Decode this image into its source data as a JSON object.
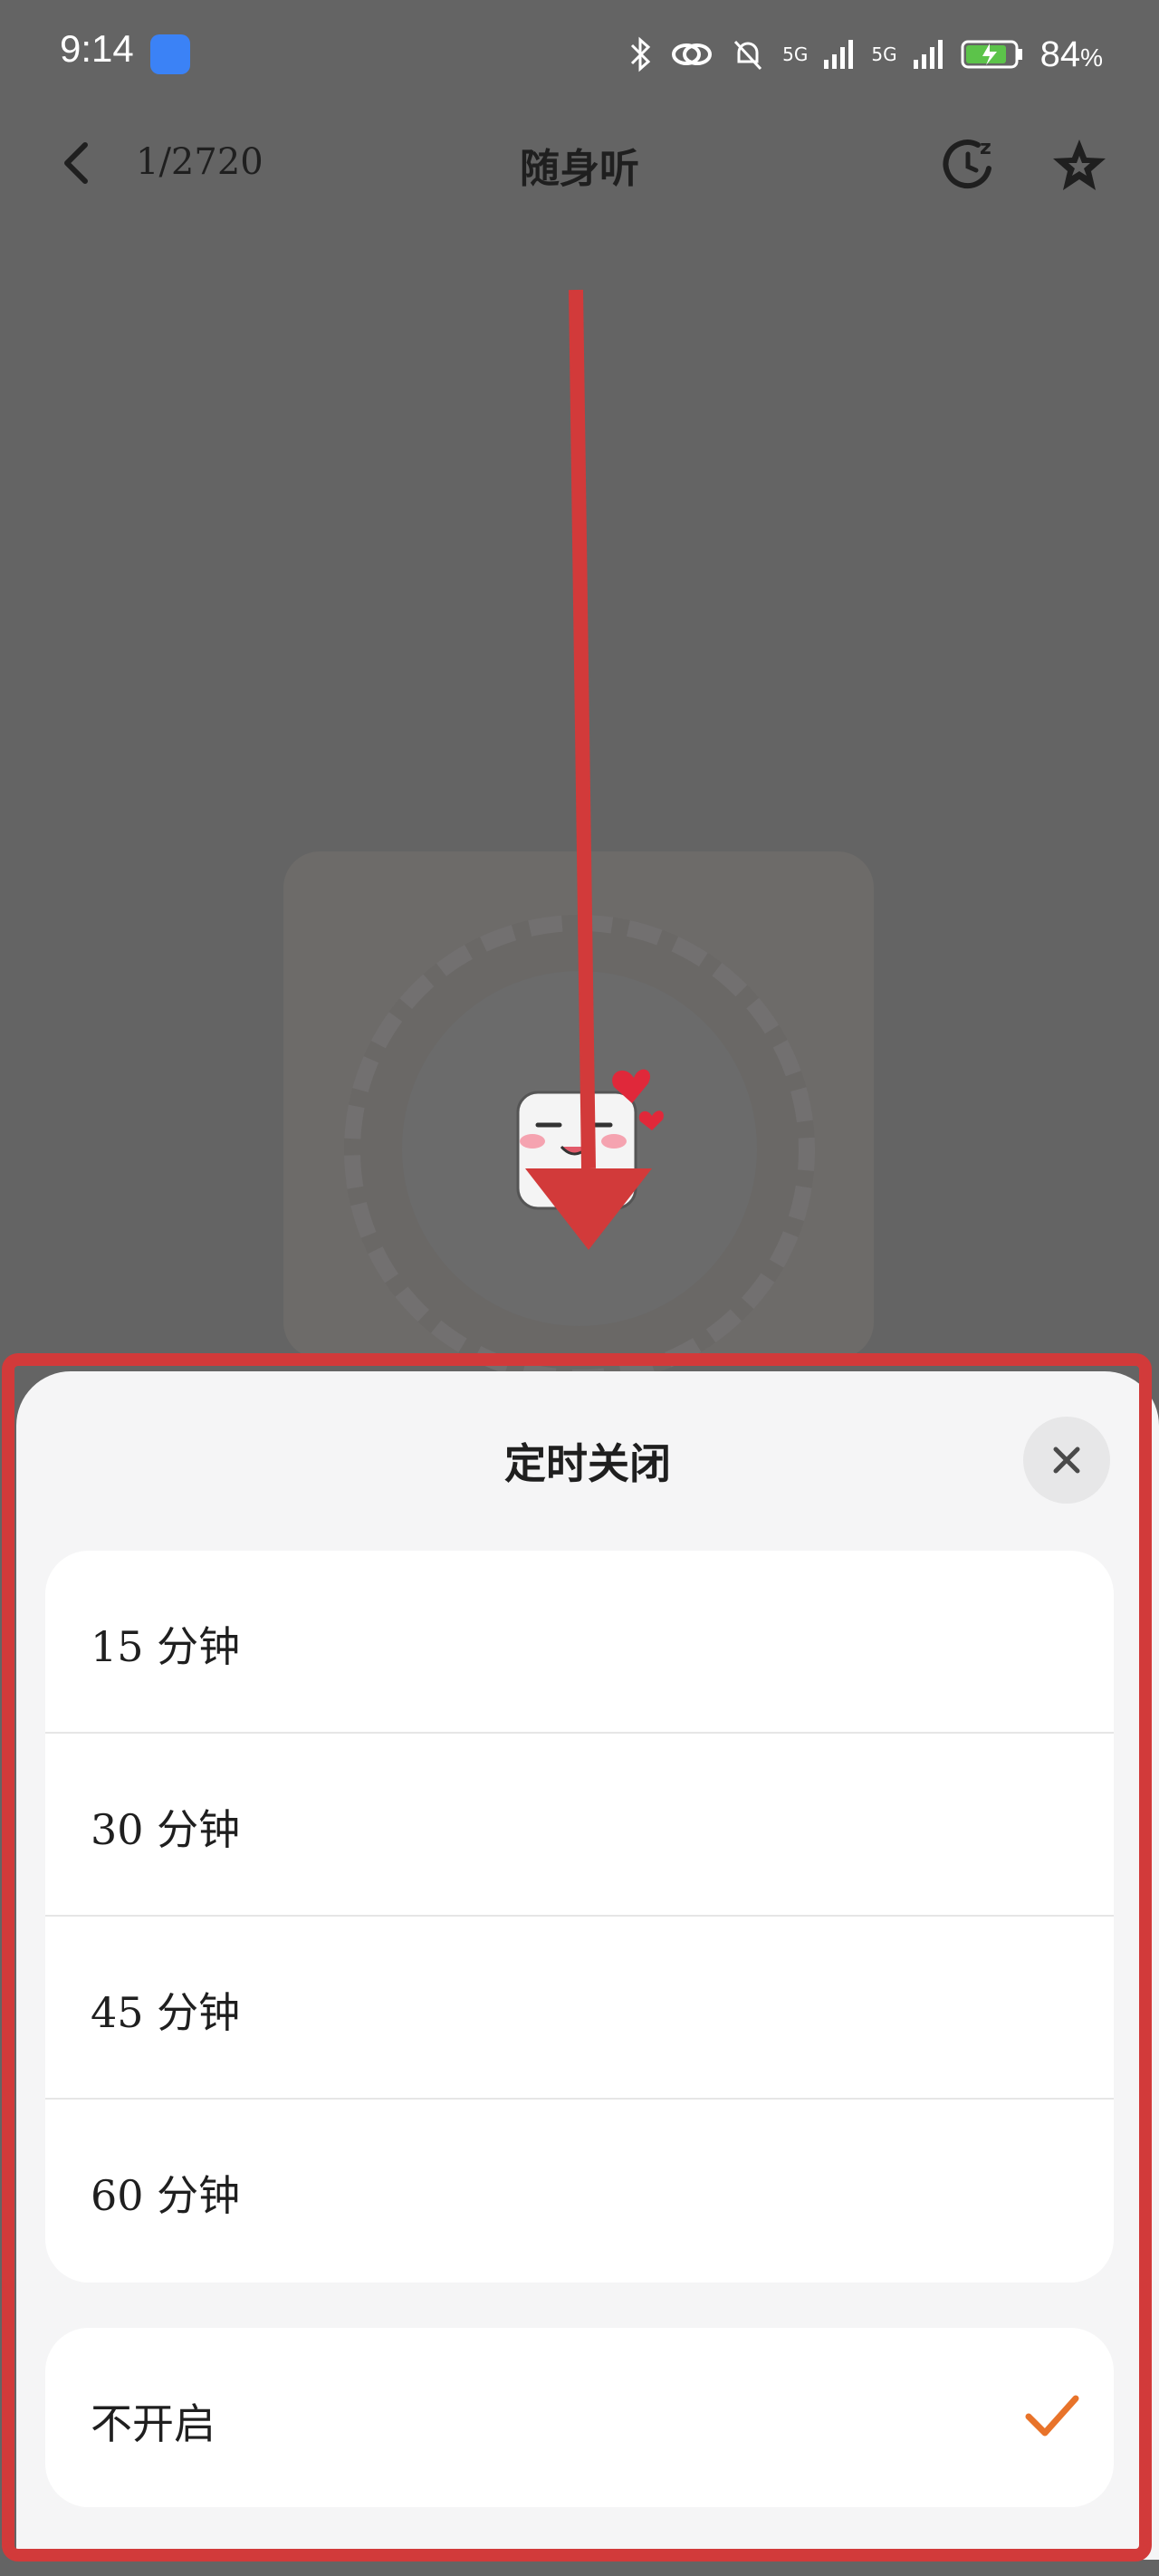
{
  "status_bar": {
    "time": "9:14",
    "network_1": "5G",
    "network_2": "5G",
    "battery": "84",
    "battery_unit": "%"
  },
  "header": {
    "counter": "1/2720",
    "title": "随身听",
    "icons": [
      "back-icon",
      "sleep-timer-icon",
      "favorite-star-icon"
    ]
  },
  "sheet": {
    "title": "定时关闭",
    "close_icon": "close-icon",
    "options": [
      {
        "label": "15 分钟"
      },
      {
        "label": "30 分钟"
      },
      {
        "label": "45 分钟"
      },
      {
        "label": "60 分钟"
      }
    ],
    "off_option": {
      "label": "不开启",
      "selected": true
    }
  },
  "colors": {
    "accent_check": "#e8732a",
    "annotation_red": "#d23a3a",
    "overlay": "#646464"
  }
}
